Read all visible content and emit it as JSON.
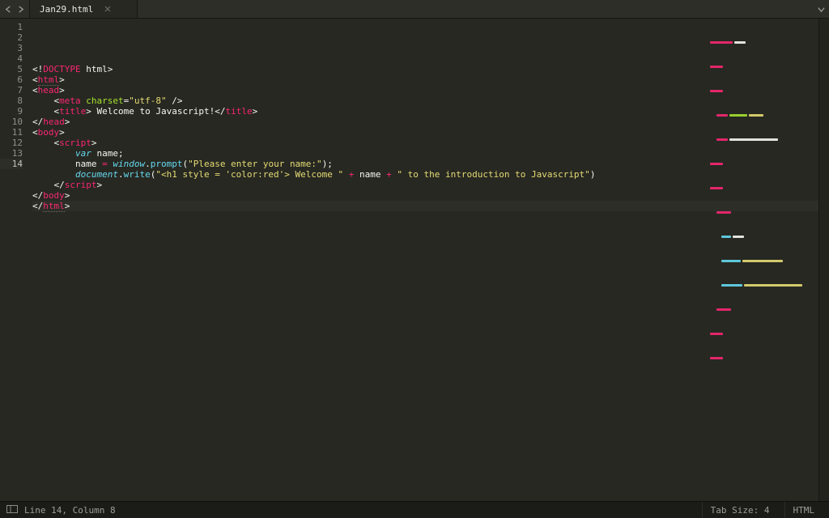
{
  "tab": {
    "filename": "Jan29.html"
  },
  "status": {
    "line_col": "Line 14, Column 8",
    "tab_size": "Tab Size: 4",
    "syntax": "HTML"
  },
  "editor": {
    "active_line": 14,
    "lines": [
      {
        "n": 1,
        "indent": 0,
        "tokens": [
          {
            "t": "<!",
            "c": "p"
          },
          {
            "t": "DOCTYPE",
            "c": "kw"
          },
          {
            "t": " html",
            "c": "tx"
          },
          {
            "t": ">",
            "c": "p"
          }
        ]
      },
      {
        "n": 2,
        "indent": 0,
        "tokens": [
          {
            "t": "<",
            "c": "p"
          },
          {
            "t": "html",
            "c": "tg",
            "dotted": true
          },
          {
            "t": ">",
            "c": "p"
          }
        ]
      },
      {
        "n": 3,
        "indent": 0,
        "tokens": [
          {
            "t": "<",
            "c": "p"
          },
          {
            "t": "head",
            "c": "tg"
          },
          {
            "t": ">",
            "c": "p"
          }
        ]
      },
      {
        "n": 4,
        "indent": 1,
        "tokens": [
          {
            "t": "<",
            "c": "p"
          },
          {
            "t": "meta",
            "c": "tg"
          },
          {
            "t": " ",
            "c": "p"
          },
          {
            "t": "charset",
            "c": "at"
          },
          {
            "t": "=",
            "c": "p"
          },
          {
            "t": "\"utf-8\"",
            "c": "st"
          },
          {
            "t": " />",
            "c": "p"
          }
        ]
      },
      {
        "n": 5,
        "indent": 1,
        "tokens": [
          {
            "t": "<",
            "c": "p"
          },
          {
            "t": "title",
            "c": "tg"
          },
          {
            "t": ">",
            "c": "p"
          },
          {
            "t": " Welcome to Javascript!",
            "c": "tx"
          },
          {
            "t": "</",
            "c": "p"
          },
          {
            "t": "title",
            "c": "tg"
          },
          {
            "t": ">",
            "c": "p"
          }
        ]
      },
      {
        "n": 6,
        "indent": 0,
        "tokens": [
          {
            "t": "</",
            "c": "p"
          },
          {
            "t": "head",
            "c": "tg"
          },
          {
            "t": ">",
            "c": "p"
          }
        ]
      },
      {
        "n": 7,
        "indent": 0,
        "tokens": [
          {
            "t": "<",
            "c": "p"
          },
          {
            "t": "body",
            "c": "tg"
          },
          {
            "t": ">",
            "c": "p"
          }
        ]
      },
      {
        "n": 8,
        "indent": 1,
        "tokens": [
          {
            "t": "<",
            "c": "p"
          },
          {
            "t": "script",
            "c": "tg"
          },
          {
            "t": ">",
            "c": "p"
          }
        ]
      },
      {
        "n": 9,
        "indent": 2,
        "tokens": [
          {
            "t": "var",
            "c": "id"
          },
          {
            "t": " name;",
            "c": "tx"
          }
        ]
      },
      {
        "n": 10,
        "indent": 2,
        "tokens": [
          {
            "t": "name ",
            "c": "tx"
          },
          {
            "t": "=",
            "c": "op"
          },
          {
            "t": " ",
            "c": "tx"
          },
          {
            "t": "window",
            "c": "id"
          },
          {
            "t": ".",
            "c": "p"
          },
          {
            "t": "prompt",
            "c": "fn"
          },
          {
            "t": "(",
            "c": "p"
          },
          {
            "t": "\"Please enter your name:\"",
            "c": "st"
          },
          {
            "t": ");",
            "c": "p"
          }
        ]
      },
      {
        "n": 11,
        "indent": 2,
        "tokens": [
          {
            "t": "document",
            "c": "id"
          },
          {
            "t": ".",
            "c": "p"
          },
          {
            "t": "write",
            "c": "fn"
          },
          {
            "t": "(",
            "c": "p"
          },
          {
            "t": "\"<h1 style = 'color:red'> Welcome \"",
            "c": "st"
          },
          {
            "t": " ",
            "c": "p"
          },
          {
            "t": "+",
            "c": "op"
          },
          {
            "t": " name ",
            "c": "tx"
          },
          {
            "t": "+",
            "c": "op"
          },
          {
            "t": " ",
            "c": "p"
          },
          {
            "t": "\" to the introduction to Javascript\"",
            "c": "st"
          },
          {
            "t": ")",
            "c": "p"
          }
        ]
      },
      {
        "n": 12,
        "indent": 1,
        "tokens": [
          {
            "t": "</",
            "c": "p"
          },
          {
            "t": "script",
            "c": "tg"
          },
          {
            "t": ">",
            "c": "p"
          }
        ]
      },
      {
        "n": 13,
        "indent": 0,
        "tokens": [
          {
            "t": "</",
            "c": "p"
          },
          {
            "t": "body",
            "c": "tg"
          },
          {
            "t": ">",
            "c": "p"
          }
        ]
      },
      {
        "n": 14,
        "indent": 0,
        "tokens": [
          {
            "t": "</",
            "c": "p"
          },
          {
            "t": "html",
            "c": "tg",
            "dotted": true
          },
          {
            "t": ">",
            "c": "p"
          }
        ]
      }
    ]
  }
}
